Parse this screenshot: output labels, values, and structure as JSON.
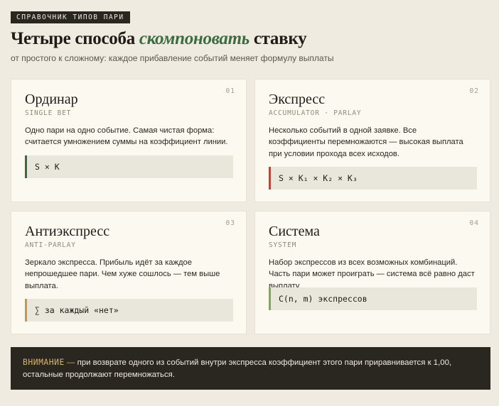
{
  "header": {
    "tag": "СПРАВОЧНИК ТИПОВ ПАРИ",
    "title_before": "Четыре способа ",
    "title_accent": "скомпоновать",
    "title_after": " ставку",
    "subtitle": "от простого к сложному: каждое прибавление событий меняет формулу выплаты"
  },
  "cards": [
    {
      "num": "01",
      "title": "Ординар",
      "subtitle": "SINGLE BET",
      "description": "Одно пари на одно событие. Самая чистая форма: считается умножением суммы на коэффициент линии.",
      "formula": "S × K",
      "accent_color": "#3b6b3f"
    },
    {
      "num": "02",
      "title": "Экспресс",
      "subtitle": "ACCUMULATOR · PARLAY",
      "description": "Несколько событий в одной заявке. Все коэффициенты перемножаются — высокая выплата при условии прохода всех исходов.",
      "formula": "S × K₁ × K₂ × K₃",
      "accent_color": "#b5483f"
    },
    {
      "num": "03",
      "title": "Антиэкспресс",
      "subtitle": "ANTI-PARLAY",
      "description": "Зеркало экспресса. Прибыль идёт за каждое непрошедшее пари. Чем хуже сошлось — тем выше выплата.",
      "formula": "∑ за каждый «нет»",
      "accent_color": "#c09a4e"
    },
    {
      "num": "04",
      "title": "Система",
      "subtitle": "SYSTEM",
      "description": "Набор экспрессов из всех возможных комбинаций. Часть пари может проиграть — система всё равно даст выплату.",
      "formula": "C(n, m) экспрессов",
      "accent_color": "#8aa06c"
    }
  ],
  "notice": {
    "label": "ВНИМАНИЕ",
    "dash": "—",
    "text": "при возврате одного из событий внутри экспресса коэффициент этого пари приравнивается к 1,00, остальные продолжают перемножаться."
  },
  "colors": {
    "background": "#efebe0",
    "card": "#fcf9f1",
    "dark": "#2a2620",
    "accent_green": "#3b6b3f",
    "notice_label": "#d9b36a"
  }
}
